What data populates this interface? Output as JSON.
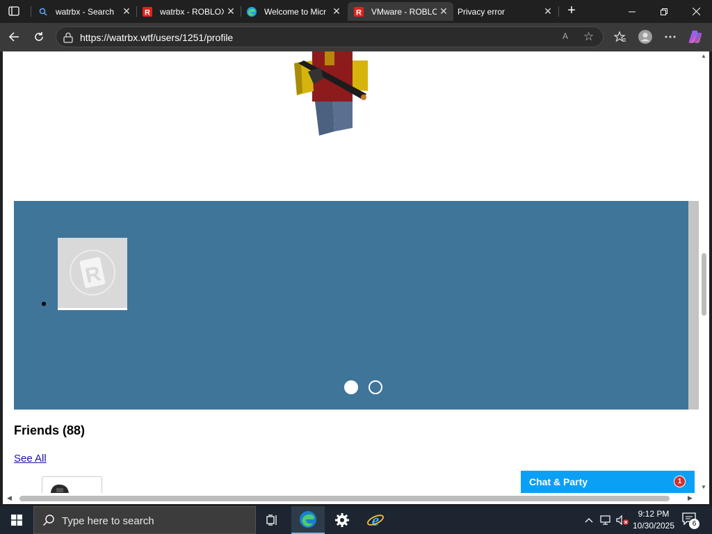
{
  "browser": {
    "tabs": [
      {
        "title": "watrbx - Search",
        "favicon": "search-icon",
        "active": false
      },
      {
        "title": "watrbx - ROBLOX",
        "favicon": "roblox-icon",
        "active": false
      },
      {
        "title": "Welcome to Micr",
        "favicon": "edge-icon",
        "active": false
      },
      {
        "title": "VMware - ROBLO",
        "favicon": "roblox-icon",
        "active": true
      },
      {
        "title": "Privacy error",
        "favicon": "none",
        "active": false
      }
    ],
    "close_glyph": "✕",
    "new_tab_glyph": "+",
    "url": "https://watrbx.wtf/users/1251/profile",
    "read_aloud_glyph": "A",
    "favorite_glyph": "☆"
  },
  "page": {
    "friends_heading": "Friends (88)",
    "see_all_link": "See All",
    "carousel": {
      "slide_count": 2,
      "active_slide": 1,
      "background_color": "#3f7599"
    },
    "chat": {
      "label": "Chat & Party",
      "badge_count": "1",
      "color": "#0aa0f5"
    }
  },
  "taskbar": {
    "search_placeholder": "Type here to search",
    "time": "9:12 PM",
    "date": "10/30/2025",
    "notification_count": "6",
    "pinned": [
      "task-view-icon",
      "edge-icon",
      "settings-icon",
      "internet-explorer-icon"
    ]
  }
}
